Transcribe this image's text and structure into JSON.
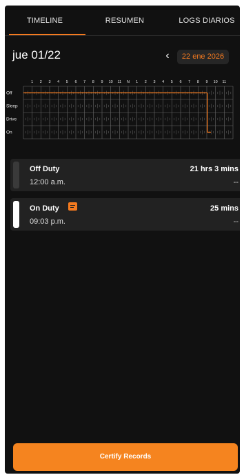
{
  "tabs": [
    {
      "label": "TIMELINE",
      "active": true
    },
    {
      "label": "RESUMEN",
      "active": false
    },
    {
      "label": "LOGS DIARIOS",
      "active": false
    }
  ],
  "header": {
    "day_label": "jue 01/22",
    "date_pill": "22 ene 2026",
    "prev_icon": "chevron-left-icon"
  },
  "chart_data": {
    "type": "line",
    "hour_labels": [
      "1",
      "2",
      "3",
      "4",
      "5",
      "6",
      "7",
      "8",
      "9",
      "10",
      "11",
      "N",
      "1",
      "2",
      "3",
      "4",
      "5",
      "6",
      "7",
      "8",
      "9",
      "10",
      "11"
    ],
    "status_rows": [
      "Off",
      "Sleep",
      "Drive",
      "On"
    ],
    "segments": [
      {
        "status": "Off",
        "start_hour": 0,
        "end_hour": 21.05
      },
      {
        "status": "On",
        "start_hour": 21.05,
        "end_hour": 21.47
      }
    ],
    "colors": {
      "line": "#f47a1f",
      "grid": "#6a6a6a"
    }
  },
  "records": [
    {
      "status": "Off Duty",
      "time": "12:00 a.m.",
      "duration": "21 hrs 3 mins",
      "extra": "--",
      "bar_color": "#3a3a3a",
      "has_note": false
    },
    {
      "status": "On Duty",
      "time": "09:03 p.m.",
      "duration": "25 mins",
      "extra": "--",
      "bar_color": "#ffffff",
      "has_note": true
    }
  ],
  "footer": {
    "certify_label": "Certify Records"
  },
  "colors": {
    "accent": "#f47a1f",
    "background": "#111111",
    "card": "#222222"
  }
}
